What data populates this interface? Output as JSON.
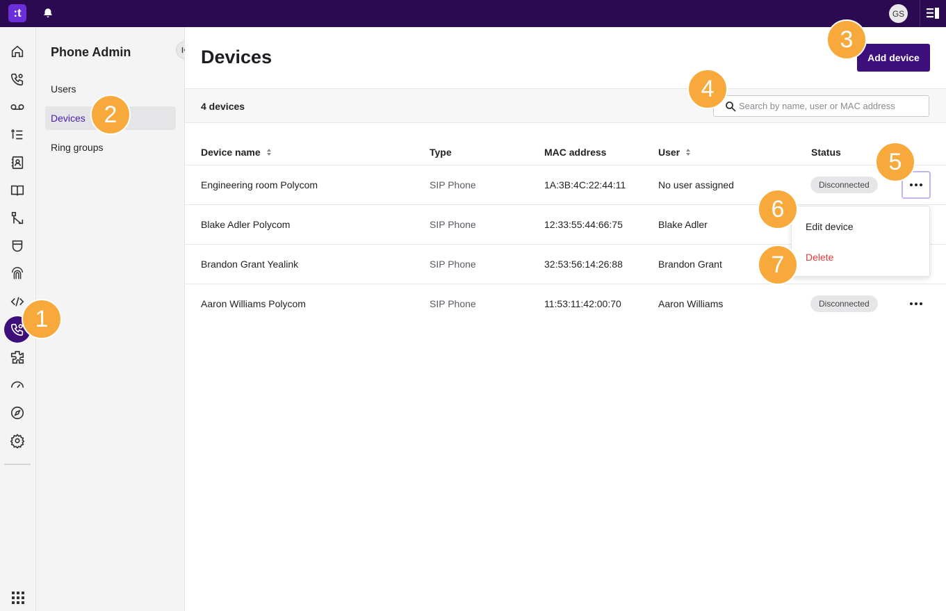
{
  "topbar": {
    "logo_text": ":t",
    "avatar_initials": "GS"
  },
  "rail": {
    "icons": [
      "home-icon",
      "calls-icon",
      "voicemail-icon",
      "queue-list-icon",
      "contacts-icon",
      "book-icon",
      "routing-icon",
      "shield-icon",
      "fingerprint-icon",
      "code-icon",
      "phone-admin-icon",
      "integrations-icon",
      "speedometer-icon",
      "compass-icon",
      "gear-icon",
      "apps-grid-icon"
    ],
    "active": "phone-admin-icon"
  },
  "subnav": {
    "title": "Phone Admin",
    "items": [
      {
        "label": "Users"
      },
      {
        "label": "Devices"
      },
      {
        "label": "Ring groups"
      }
    ],
    "active_index": 1
  },
  "main": {
    "title": "Devices",
    "add_button": "Add device",
    "count_label": "4 devices",
    "search_placeholder": "Search by name, user or MAC address",
    "columns": [
      "Device name",
      "Type",
      "MAC address",
      "User",
      "Status"
    ],
    "rows": [
      {
        "name": "Engineering room Polycom",
        "type": "SIP Phone",
        "mac": "1A:3B:4C:22:44:11",
        "user": "No user assigned",
        "status": "Disconnected"
      },
      {
        "name": "Blake Adler Polycom",
        "type": "SIP Phone",
        "mac": "12:33:55:44:66:75",
        "user": "Blake Adler",
        "status": ""
      },
      {
        "name": "Brandon Grant Yealink",
        "type": "SIP Phone",
        "mac": "32:53:56:14:26:88",
        "user": "Brandon Grant",
        "status": ""
      },
      {
        "name": "Aaron Williams Polycom",
        "type": "SIP Phone",
        "mac": "11:53:11:42:00:70",
        "user": "Aaron Williams",
        "status": "Disconnected"
      }
    ]
  },
  "menu": {
    "edit": "Edit device",
    "delete": "Delete"
  },
  "callouts": [
    "1",
    "2",
    "3",
    "4",
    "5",
    "6",
    "7"
  ],
  "colors": {
    "brand": "#3c0f7a",
    "topbar": "#2b0a52",
    "callout": "#f7a93c",
    "danger": "#e03b3b"
  }
}
